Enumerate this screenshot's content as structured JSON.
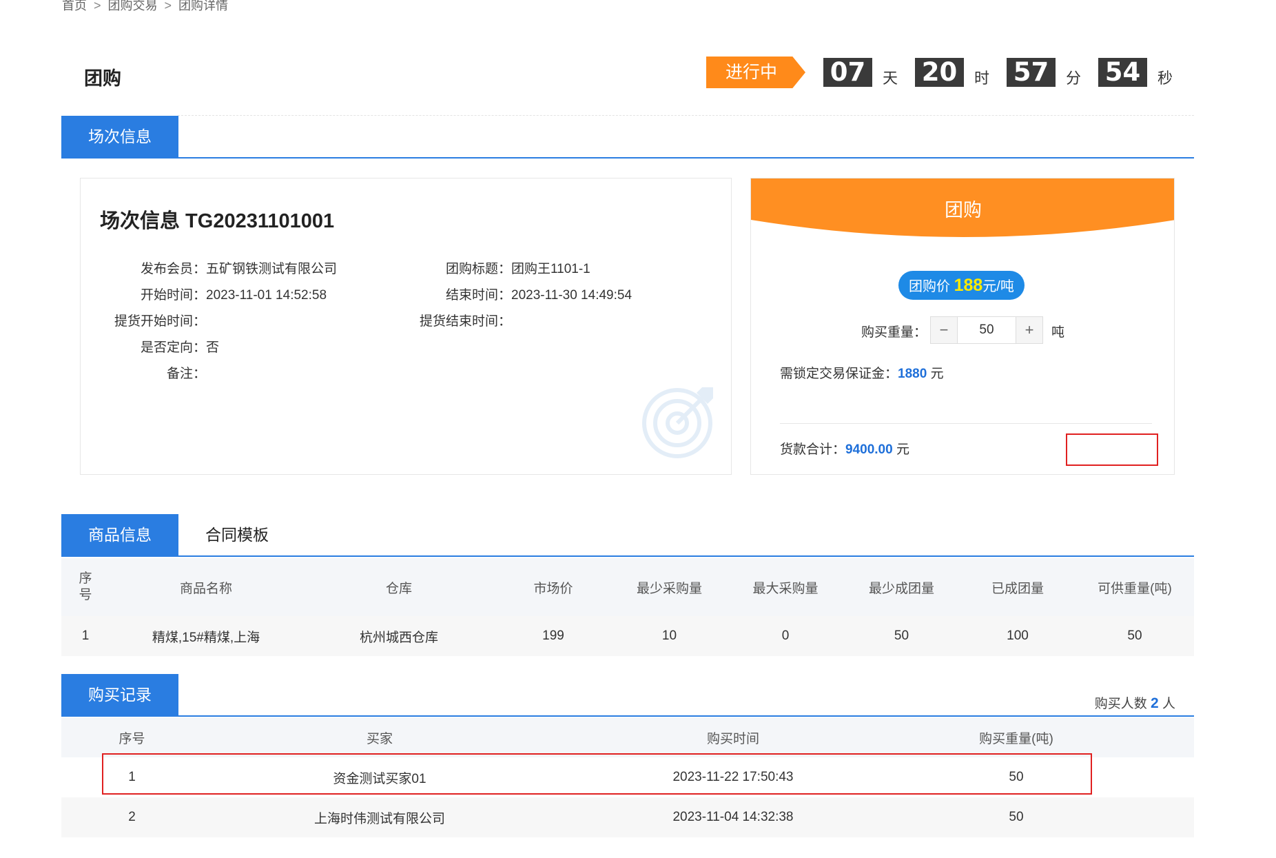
{
  "breadcrumb": [
    "首页",
    "团购交易",
    "团购详情"
  ],
  "breadcrumb_sep": ">",
  "page_title": "团购",
  "status": "进行中",
  "countdown": {
    "days": "07",
    "days_unit": "天",
    "hours": "20",
    "hours_unit": "时",
    "minutes": "57",
    "minutes_unit": "分",
    "seconds": "54",
    "seconds_unit": "秒"
  },
  "tabs_session": [
    "场次信息"
  ],
  "session": {
    "title": "场次信息 TG20231101001",
    "publisher_label": "发布会员：",
    "publisher": "五矿钢铁测试有限公司",
    "group_title_label": "团购标题：",
    "group_title": "团购王1101-1",
    "start_label": "开始时间：",
    "start": "2023-11-01 14:52:58",
    "end_label": "结束时间：",
    "end": "2023-11-30 14:49:54",
    "pickup_start_label": "提货开始时间：",
    "pickup_start": "",
    "pickup_end_label": "提货结束时间：",
    "pickup_end": "",
    "directed_label": "是否定向：",
    "directed": "否",
    "remark_label": "备注：",
    "remark": ""
  },
  "buy_panel": {
    "header": "团购",
    "price_prefix": "团购价",
    "price": "188",
    "price_unit": "元/吨",
    "qty_label": "购买重量：",
    "qty_minus": "−",
    "qty_value": "50",
    "qty_plus": "+",
    "qty_unit": "吨",
    "deposit_label": "需锁定交易保证金：",
    "deposit": "1880",
    "deposit_unit": " 元",
    "total_label": "货款合计：",
    "total": "9400.00",
    "total_unit": " 元"
  },
  "tabs_goods": [
    "商品信息",
    "合同模板"
  ],
  "goods_table": {
    "headers": [
      "序\n号",
      "商品名称",
      "仓库",
      "市场价",
      "最少采购量",
      "最大采购量",
      "最少成团量",
      "已成团量",
      "可供重量(吨)"
    ],
    "rows": [
      [
        "1",
        "精煤,15#精煤,上海",
        "杭州城西仓库",
        "199",
        "10",
        "0",
        "50",
        "100",
        "50"
      ]
    ]
  },
  "tabs_records": [
    "购买记录"
  ],
  "records": {
    "count_label": "购买人数",
    "count": "2",
    "count_unit": "人",
    "headers": [
      "序号",
      "买家",
      "购买时间",
      "购买重量(吨)"
    ],
    "rows": [
      [
        "1",
        "资金测试买家01",
        "2023-11-22 17:50:43",
        "50"
      ],
      [
        "2",
        "上海时伟测试有限公司",
        "2023-11-04 14:32:38",
        "50"
      ]
    ]
  },
  "colors": {
    "primary_blue": "#2a7de1",
    "orange": "#ff8a1a",
    "highlight_red": "#e02020"
  }
}
